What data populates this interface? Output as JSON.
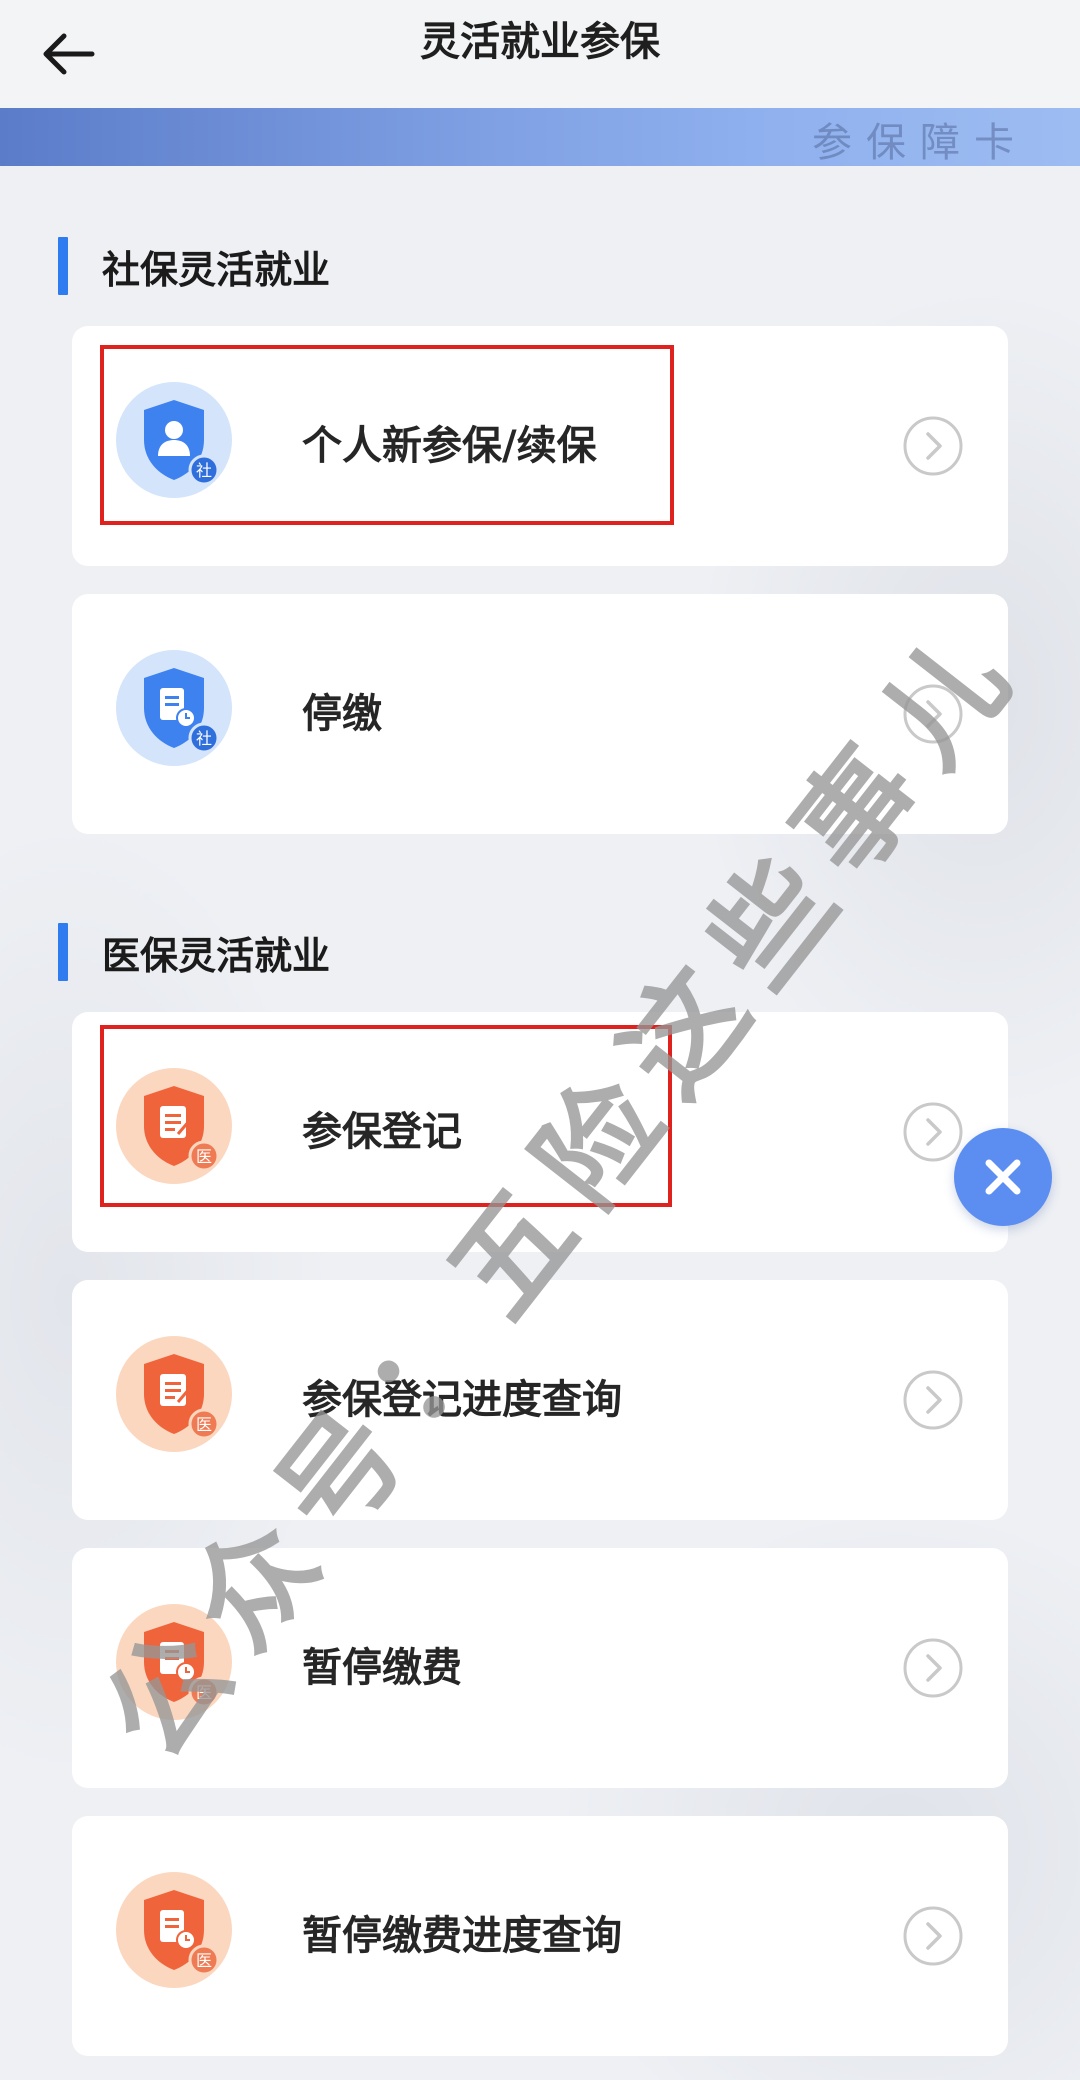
{
  "header": {
    "title": "灵活就业参保",
    "back_icon": "arrow-left-icon"
  },
  "banner": {
    "text": "参保障卡"
  },
  "sections": [
    {
      "title": "社保灵活就业",
      "accent": "#2f7cf0",
      "items": [
        {
          "label": "个人新参保/续保",
          "icon": "shield-person-icon",
          "badge": "社",
          "color": "#3e82f0"
        },
        {
          "label": "停缴",
          "icon": "shield-document-clock-icon",
          "badge": "社",
          "color": "#3e82f0"
        }
      ]
    },
    {
      "title": "医保灵活就业",
      "accent": "#2f7cf0",
      "items": [
        {
          "label": "参保登记",
          "icon": "shield-document-pen-icon",
          "badge": "医",
          "color": "#f0643c"
        },
        {
          "label": "参保登记进度查询",
          "icon": "shield-document-pen-icon",
          "badge": "医",
          "color": "#f0643c"
        },
        {
          "label": "暂停缴费",
          "icon": "shield-document-clock-icon",
          "badge": "医",
          "color": "#f0643c"
        },
        {
          "label": "暂停缴费进度查询",
          "icon": "shield-document-clock-icon",
          "badge": "医",
          "color": "#f0643c"
        }
      ]
    }
  ],
  "watermark": {
    "text": "公众号：五险这些事儿"
  },
  "floating": {
    "close_icon": "close-icon",
    "color": "#5b8ef0"
  },
  "highlights": {
    "color": "#e0221f"
  }
}
